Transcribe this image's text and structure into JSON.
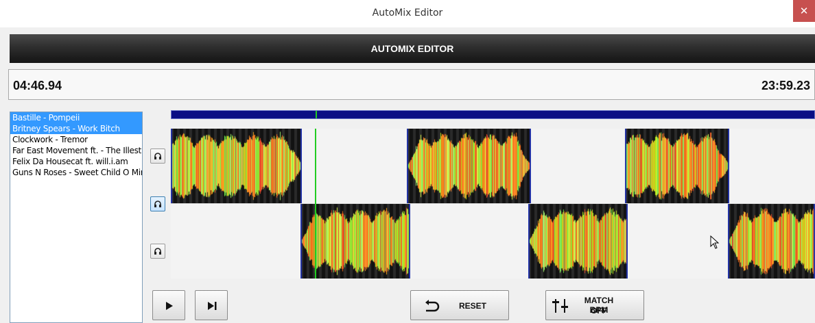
{
  "window": {
    "title": "AutoMix Editor",
    "close_symbol": "✕"
  },
  "header": {
    "title": "AUTOMIX EDITOR"
  },
  "timebar": {
    "elapsed": "04:46.94",
    "total": "23:59.23"
  },
  "tracks": [
    {
      "label": "Bastille - Pompeii",
      "selected": true
    },
    {
      "label": "Britney Spears - Work Bitch",
      "selected": true
    },
    {
      "label": "Clockwork - Tremor",
      "selected": false
    },
    {
      "label": "Far East Movement ft. - The Illest",
      "selected": false
    },
    {
      "label": "Felix Da Housecat ft. will.i.am",
      "selected": false
    },
    {
      "label": "Guns N Roses - Sweet Child O Mine",
      "selected": false
    }
  ],
  "controls": {
    "reset_label": "RESET",
    "match_bpm_label": "MATCH BPM",
    "match_bpm_state": "OFF"
  },
  "playback": {
    "playhead_fraction": 0.224
  },
  "colors": {
    "progress": "#0a0e84",
    "playhead": "#22cc22",
    "selection": "#3399ff",
    "close": "#c7504f"
  }
}
